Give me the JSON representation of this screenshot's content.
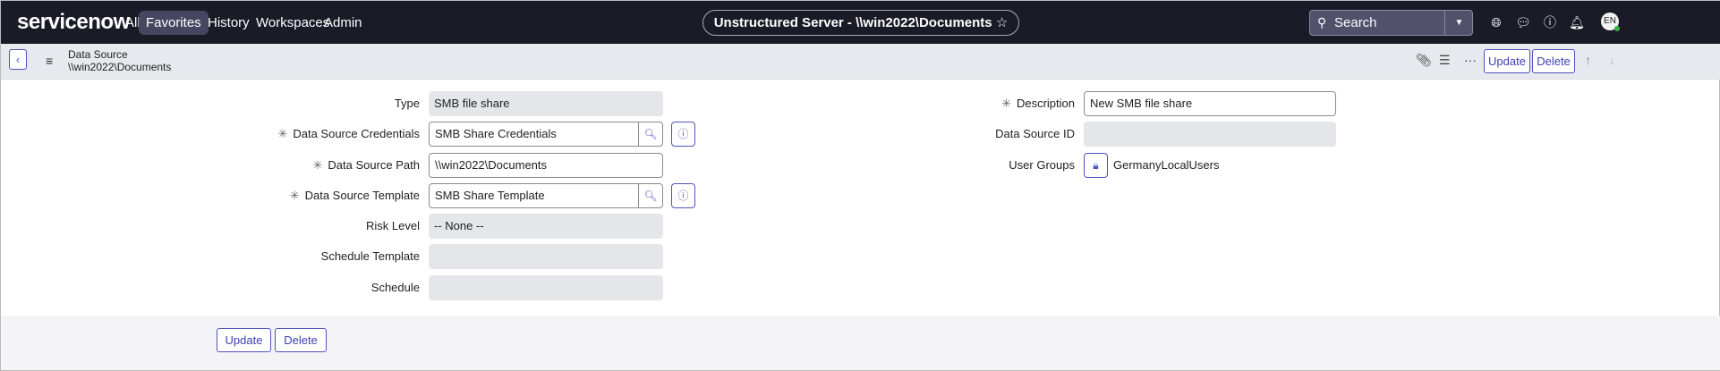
{
  "header": {
    "logo": "servicenow",
    "nav": [
      {
        "label": "All"
      },
      {
        "label": "Favorites"
      },
      {
        "label": "History"
      },
      {
        "label": "Workspaces"
      },
      {
        "label": "Admin"
      }
    ],
    "title": "Unstructured Server - \\\\win2022\\Documents",
    "star": "☆",
    "search_placeholder": "Search",
    "avatar": "EN"
  },
  "subheader": {
    "record_type": "Data Source",
    "record_name": "\\\\win2022\\Documents",
    "update": "Update",
    "delete": "Delete"
  },
  "form": {
    "left": [
      {
        "label": "Type",
        "value": "SMB file share",
        "required": false
      },
      {
        "label": "Data Source Credentials",
        "value": "SMB Share Credentials",
        "required": true
      },
      {
        "label": "Data Source Path",
        "value": "\\\\win2022\\Documents",
        "required": true
      },
      {
        "label": "Data Source Template",
        "value": "SMB Share Template",
        "required": true
      },
      {
        "label": "Risk Level",
        "value": "-- None --",
        "required": false
      },
      {
        "label": "Schedule Template",
        "value": "",
        "required": false
      },
      {
        "label": "Schedule",
        "value": "",
        "required": false
      }
    ],
    "right": [
      {
        "label": "Description",
        "value": "New SMB file share",
        "required": true
      },
      {
        "label": "Data Source ID",
        "value": "",
        "required": false
      },
      {
        "label": "User Groups",
        "value": "GermanyLocalUsers",
        "required": false
      }
    ],
    "required_mark": "✳"
  },
  "footer": {
    "update": "Update",
    "delete": "Delete"
  }
}
